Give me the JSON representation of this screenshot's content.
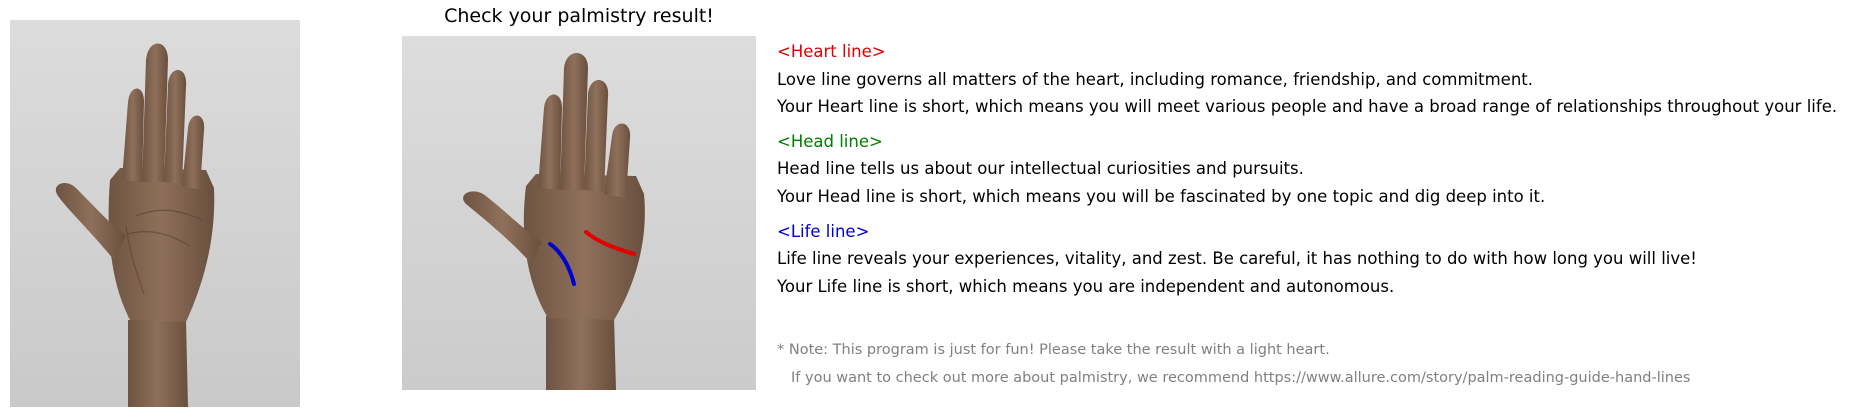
{
  "title": "Check your palmistry result!",
  "colors": {
    "heart": "#e00000",
    "head": "#008000",
    "life": "#0000cc",
    "note": "#808080"
  },
  "images": {
    "input_hand": "palm-hand-photo",
    "result_hand": "palm-hand-photo-with-lines"
  },
  "heart": {
    "heading": "<Heart line>",
    "description": "Love line governs all matters of the heart, including romance, friendship, and commitment.",
    "result": "Your Heart line is short, which means you will meet various people and have a broad range of relationships throughout your life."
  },
  "head": {
    "heading": "<Head line>",
    "description": "Head line tells us about our intellectual curiosities and pursuits.",
    "result": "Your Head line is short, which means you will be fascinated by one topic and dig deep into it."
  },
  "life": {
    "heading": "<Life line>",
    "description": "Life line reveals your experiences, vitality, and zest. Be careful, it has nothing to do with how long you will live!",
    "result": "Your Life line is short, which means you are independent and autonomous."
  },
  "note": {
    "line1": "* Note: This program is just for fun! Please take the result with a light heart.",
    "line2": "If you want to check out more about palmistry, we recommend https://www.allure.com/story/palm-reading-guide-hand-lines"
  }
}
